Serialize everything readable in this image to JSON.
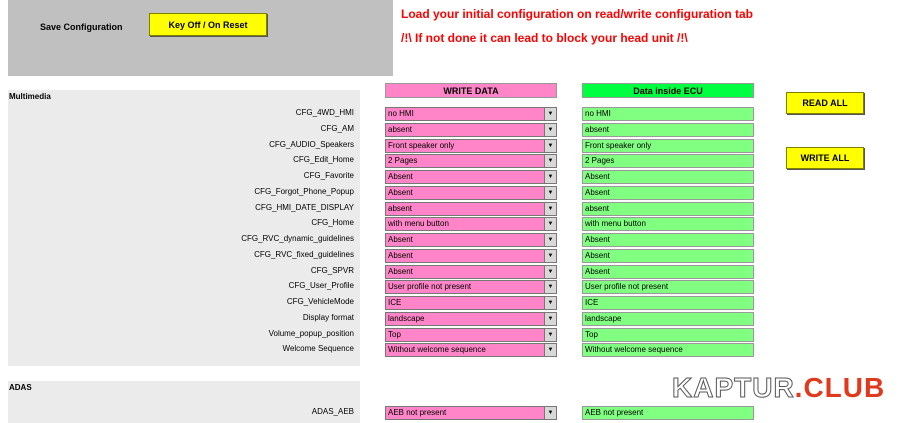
{
  "top": {
    "save_label": "Save Configuration",
    "key_off_button": "Key Off / On Reset",
    "warning_line1": "Load your initial configuration on read/write configuration tab",
    "warning_line2": "/!\\ If not done it can lead to block your head unit /!\\"
  },
  "headers": {
    "write": "WRITE DATA",
    "ecu": "Data inside ECU"
  },
  "buttons": {
    "read_all": "READ ALL",
    "write_all": "WRITE ALL"
  },
  "sections": {
    "multimedia": {
      "title": "Multimedia",
      "rows": [
        {
          "label": "CFG_4WD_HMI",
          "write": "no HMI",
          "ecu": "no HMI"
        },
        {
          "label": "CFG_AM",
          "write": "absent",
          "ecu": "absent"
        },
        {
          "label": "CFG_AUDIO_Speakers",
          "write": "Front speaker only",
          "ecu": "Front speaker only"
        },
        {
          "label": "CFG_Edit_Home",
          "write": "2 Pages",
          "ecu": "2 Pages"
        },
        {
          "label": "CFG_Favorite",
          "write": "Absent",
          "ecu": "Absent"
        },
        {
          "label": "CFG_Forgot_Phone_Popup",
          "write": "Absent",
          "ecu": "Absent"
        },
        {
          "label": "CFG_HMI_DATE_DISPLAY",
          "write": "absent",
          "ecu": "absent"
        },
        {
          "label": "CFG_Home",
          "write": "with menu button",
          "ecu": "with menu button"
        },
        {
          "label": "CFG_RVC_dynamic_guidelines",
          "write": "Absent",
          "ecu": "Absent"
        },
        {
          "label": "CFG_RVC_fixed_guidelines",
          "write": "Absent",
          "ecu": "Absent"
        },
        {
          "label": "CFG_SPVR",
          "write": "Absent",
          "ecu": "Absent"
        },
        {
          "label": "CFG_User_Profile",
          "write": "User profile not present",
          "ecu": "User profile not present"
        },
        {
          "label": "CFG_VehicleMode",
          "write": "ICE",
          "ecu": "ICE"
        },
        {
          "label": "Display format",
          "write": "landscape",
          "ecu": "landscape"
        },
        {
          "label": "Volume_popup_position",
          "write": "Top",
          "ecu": "Top"
        },
        {
          "label": "Welcome Sequence",
          "write": "Without welcome sequence",
          "ecu": "Without welcome sequence"
        }
      ]
    },
    "adas": {
      "title": "ADAS",
      "rows": [
        {
          "label": "ADAS_AEB",
          "write": "AEB not present",
          "ecu": "AEB not present"
        }
      ]
    }
  },
  "watermark": {
    "part1": "KAPTUR",
    "part2": ".CLUB"
  },
  "icons": {
    "dropdown": "dropdown-arrow-icon"
  },
  "colors": {
    "write_bg": "#ff85c8",
    "ecu_bg": "#80ff80",
    "button_bg": "#ffff00",
    "warning": "#ff0000"
  }
}
